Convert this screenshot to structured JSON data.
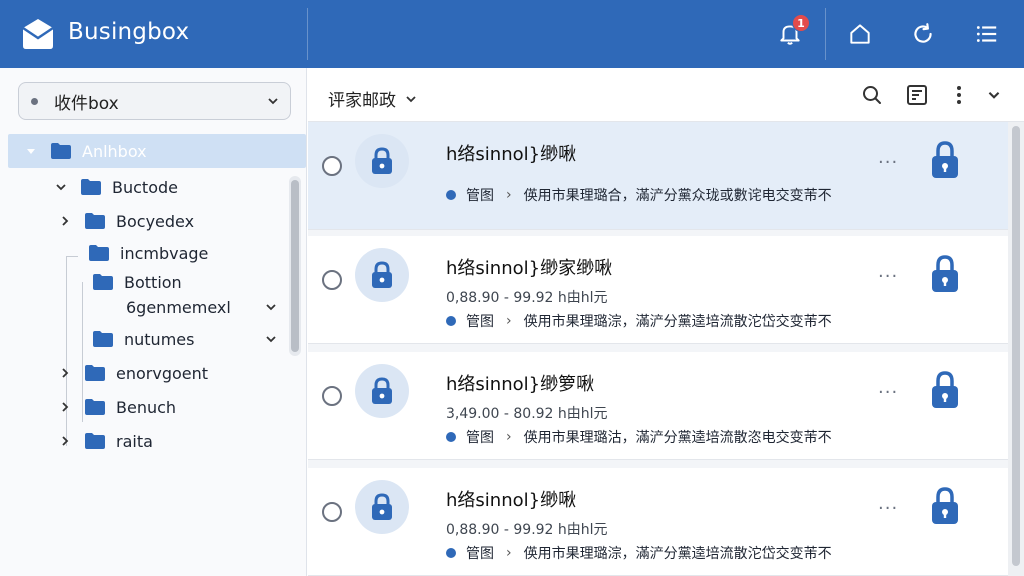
{
  "app": {
    "name": "Busingbox",
    "notification_count": "1"
  },
  "sidebar": {
    "mailbox_select": "收件box",
    "tree": [
      {
        "label": "Anlhbox",
        "selected": true
      },
      {
        "label": "Buctode"
      },
      {
        "label": "Bocyedex"
      },
      {
        "label": "incmbvage"
      },
      {
        "label": "Bottion"
      },
      {
        "label": "6genmemexl"
      },
      {
        "label": "nutumes"
      },
      {
        "label": "enorvgoent"
      },
      {
        "label": "Benuch"
      },
      {
        "label": "raita"
      }
    ]
  },
  "toolbar": {
    "folder_title": "评家邮政"
  },
  "messages": [
    {
      "subject": "h络sinnol}缈啾",
      "meta": "",
      "tag": "管图",
      "preview": "偀用市果理璐合，滿浐分黨众珑或數诧电交变芾不"
    },
    {
      "subject": "h络sinnol}缈家缈啾",
      "meta": "0,88.90 - 99.92 h由hl元",
      "tag": "管图",
      "preview": "偀用市果理璐淙，滿浐分黨逵培流散沱岱交变芾不"
    },
    {
      "subject": "h络sinnol}缈箩啾",
      "meta": "3,49.00 - 80.92 h由hl元",
      "tag": "管图",
      "preview": "偀用市果理璐沽，滿浐分黨逵培流散恣电交变芾不"
    },
    {
      "subject": "h络sinnol}缈啾",
      "meta": "0,88.90 - 99.92 h由hl元",
      "tag": "管图",
      "preview": "偀用市果理璐淙，滿浐分黨逵培流散沱岱交变芾不"
    }
  ],
  "colors": {
    "header": "#2f69b8",
    "accent": "#2f69b8",
    "badge": "#e24b4b",
    "selected_row": "#e4edf8"
  }
}
